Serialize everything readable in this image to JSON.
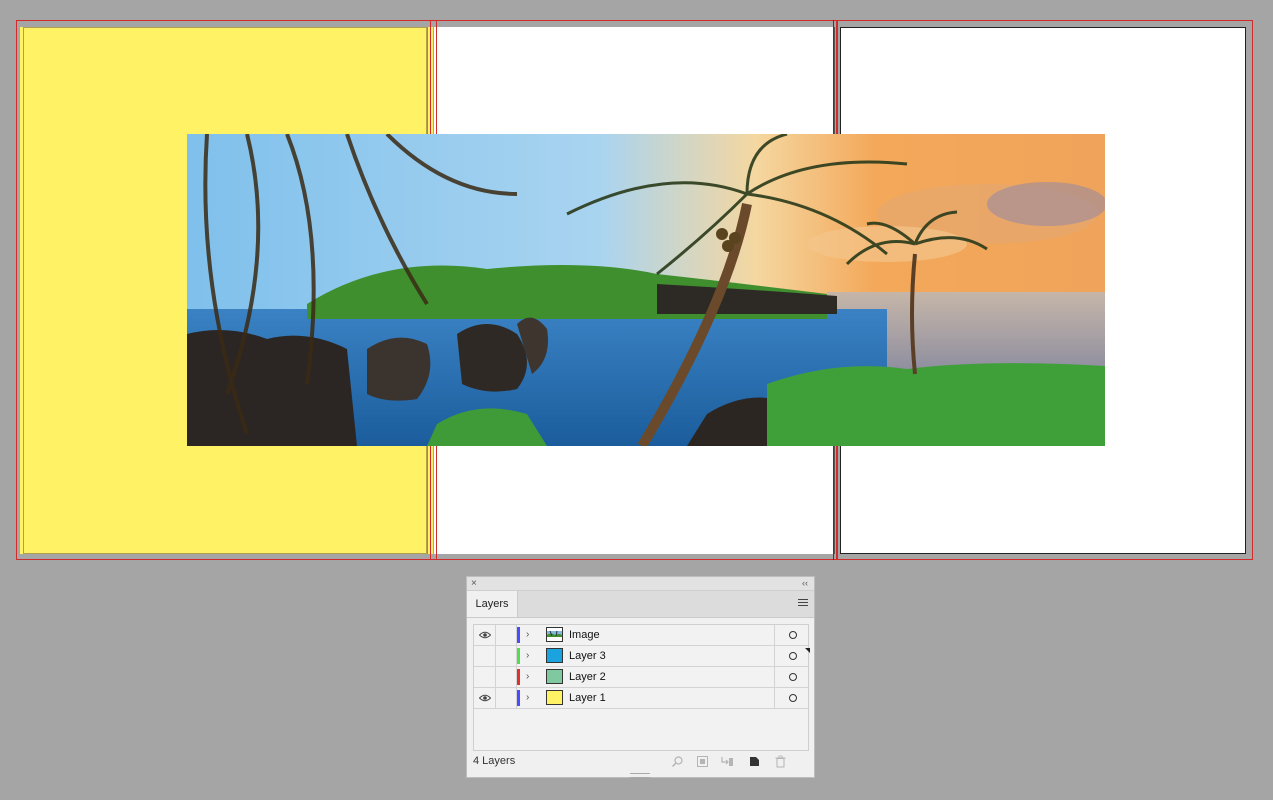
{
  "panel": {
    "close_icon": "×",
    "collapse_icon": "‹‹",
    "tab_label": "Layers",
    "footer_count": "4 Layers"
  },
  "layers": [
    {
      "name": "Image",
      "visible": true,
      "color": "#4b4bff",
      "thumb": "landscape"
    },
    {
      "name": "Layer 3",
      "visible": false,
      "color": "#4fe04f",
      "thumb": "#1aa3df"
    },
    {
      "name": "Layer 2",
      "visible": false,
      "color": "#e03030",
      "thumb": "#7fc8a0"
    },
    {
      "name": "Layer 1",
      "visible": true,
      "color": "#4b4bff",
      "thumb": "#fff264"
    }
  ],
  "colors": {
    "artboard_yellow": "#fff264",
    "bleed_red": "#d22b2b",
    "pasteboard": "#a5a5a5"
  },
  "icons": {
    "eye": "eye-icon",
    "chevron": "chevron-right-icon",
    "target": "target-circle-icon",
    "menu": "panel-menu-icon",
    "search": "search-icon",
    "clip": "clipping-mask-icon",
    "sublayer": "new-sublayer-icon",
    "newlayer": "new-layer-icon",
    "trash": "trash-icon"
  }
}
